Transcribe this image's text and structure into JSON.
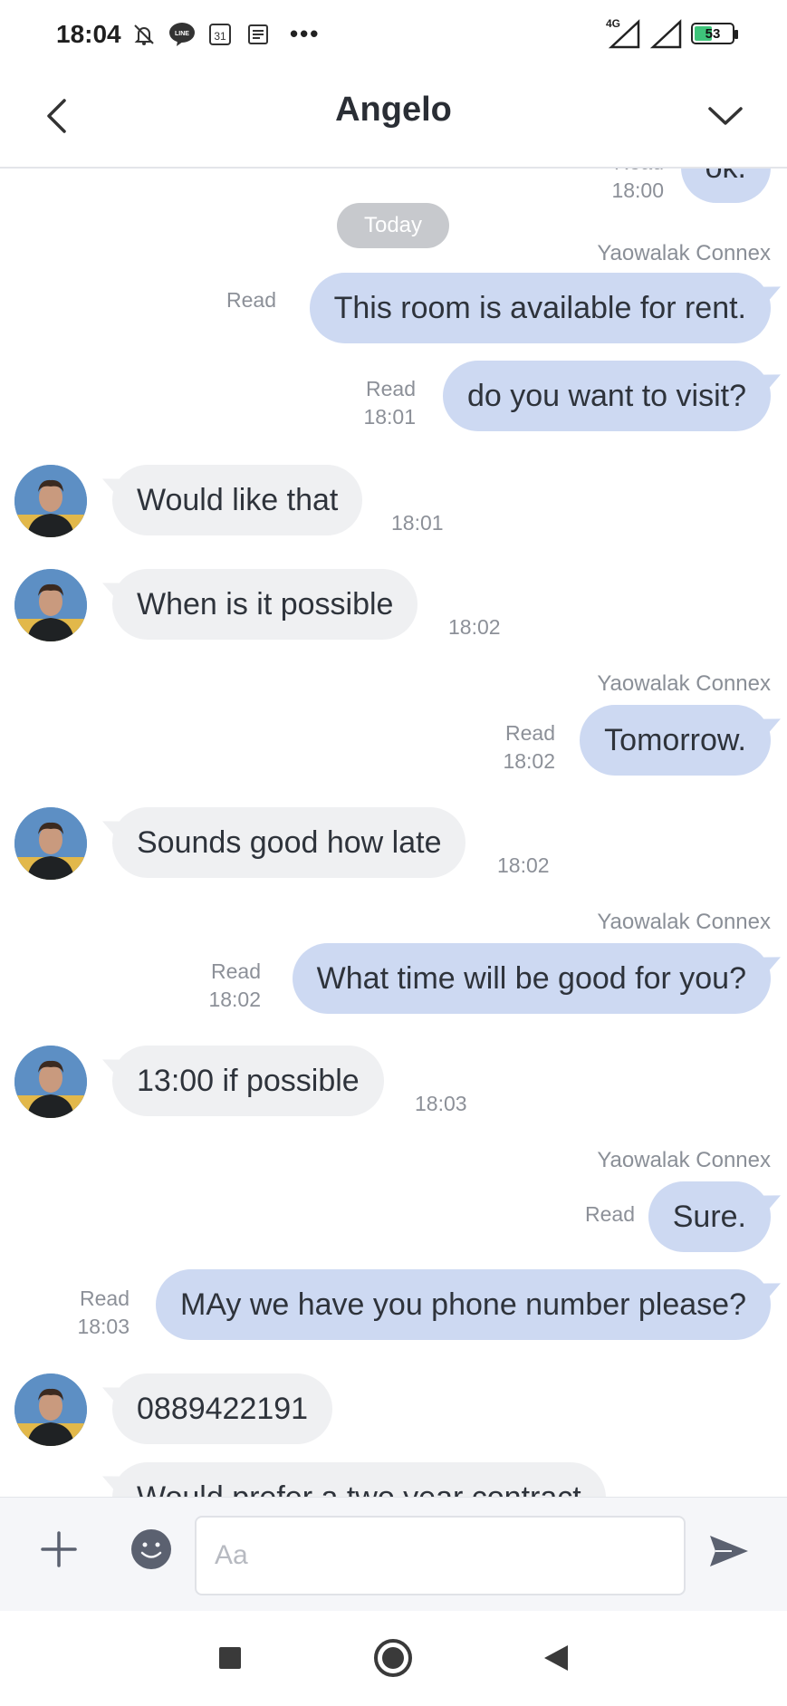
{
  "status_bar": {
    "time": "18:04",
    "network": "4G",
    "battery": "53",
    "battery_level": 0.53,
    "calendar_day": "31"
  },
  "header": {
    "title": "Angelo"
  },
  "chat": {
    "partial_top_read": "Read",
    "partial_top_time": "18:00",
    "partial_top_text": "ok.",
    "day_separator": "Today",
    "messages": [
      {
        "sender": "Yaowalak Connex",
        "read": "Read",
        "time": "",
        "text": "This room is available for rent."
      },
      {
        "read": "Read",
        "time": "18:01",
        "text": "do you want to visit?"
      },
      {
        "text": "Would like that",
        "time": "18:01"
      },
      {
        "text": "When is it possible",
        "time": "18:02"
      },
      {
        "sender": "Yaowalak Connex",
        "read": "Read",
        "time": "18:02",
        "text": "Tomorrow."
      },
      {
        "text": "Sounds good how late",
        "time": "18:02"
      },
      {
        "sender": "Yaowalak Connex",
        "read": "Read",
        "time": "18:02",
        "text": "What time will be good for you?"
      },
      {
        "text": "13:00 if possible",
        "time": "18:03"
      },
      {
        "sender": "Yaowalak Connex",
        "read": "Read",
        "time": "",
        "text": "Sure."
      },
      {
        "read": "Read",
        "time": "18:03",
        "text": "MAy we have you phone number please?"
      },
      {
        "text": "0889422191",
        "time": ""
      },
      {
        "text": "Would prefer a two year contract",
        "time": ""
      }
    ]
  },
  "input_bar": {
    "placeholder": "Aa",
    "value": ""
  }
}
